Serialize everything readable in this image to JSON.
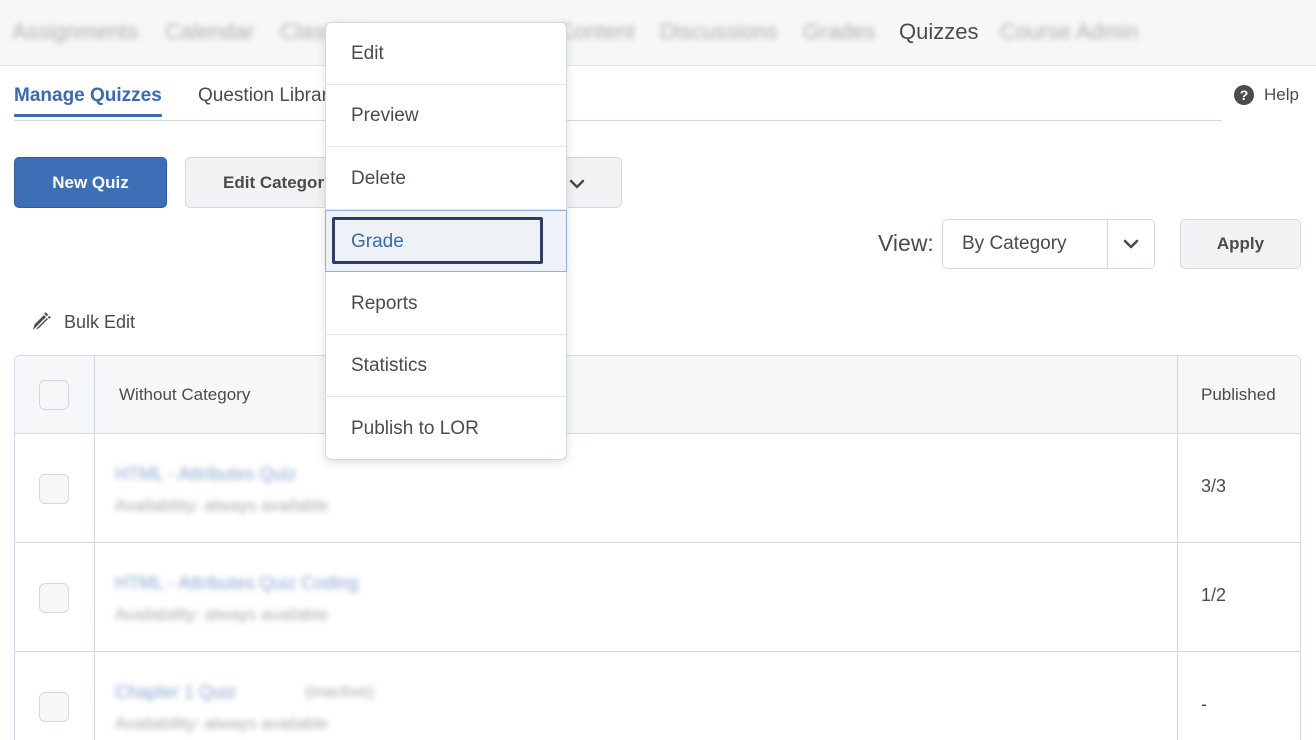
{
  "topnav": {
    "items": [
      {
        "label": "Assignments"
      },
      {
        "label": "Calendar"
      },
      {
        "label": "Classlist"
      },
      {
        "label": "Content"
      },
      {
        "label": "Discussions"
      },
      {
        "label": "Grades"
      },
      {
        "label": "Quizzes"
      },
      {
        "label": "Course Admin"
      }
    ]
  },
  "tabs": {
    "manage": "Manage Quizzes",
    "question_library": "Question Library",
    "help": "Help"
  },
  "toolbar": {
    "new_quiz": "New Quiz",
    "edit_categories": "Edit Categories"
  },
  "view": {
    "label": "View:",
    "selected": "By Category",
    "apply": "Apply"
  },
  "bulk_edit": "Bulk Edit",
  "table": {
    "header_category": "Without Category",
    "header_published": "Published",
    "rows": [
      {
        "title": "HTML - Attributes Quiz",
        "availability": "Availability: always available",
        "published": "3/3",
        "inactive": ""
      },
      {
        "title": "HTML - Attributes Quiz Coding",
        "availability": "Availability: always available",
        "published": "1/2",
        "inactive": ""
      },
      {
        "title": "Chapter 1 Quiz",
        "availability": "Availability: always available",
        "published": "-",
        "inactive": "(inactive)"
      }
    ]
  },
  "context_menu": {
    "items": [
      {
        "label": "Edit"
      },
      {
        "label": "Preview"
      },
      {
        "label": "Delete"
      },
      {
        "label": "Grade"
      },
      {
        "label": "Reports"
      },
      {
        "label": "Statistics"
      },
      {
        "label": "Publish to LOR"
      }
    ],
    "highlighted": "Grade"
  },
  "colors": {
    "accent": "#3d6fb6",
    "link": "#3b6ab0",
    "text": "#494c4e",
    "border": "#d3d9e3",
    "focus": "#2f3e66"
  }
}
